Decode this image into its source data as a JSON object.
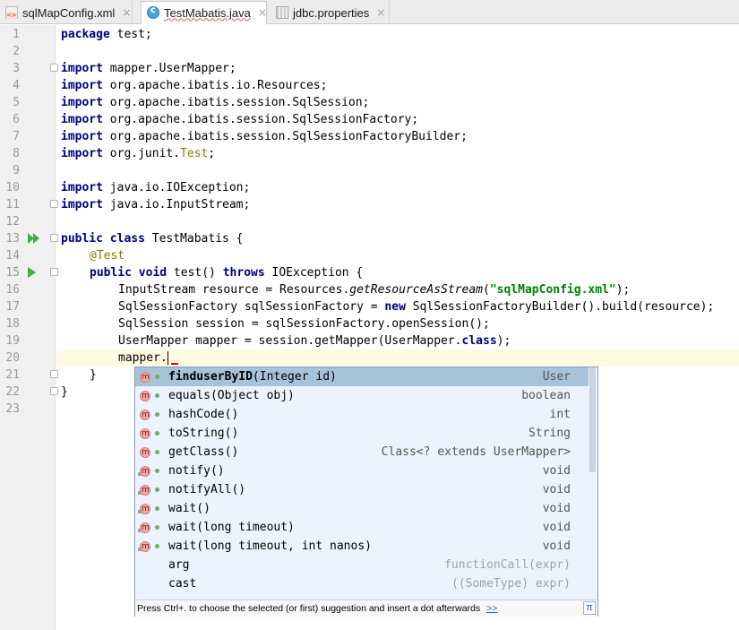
{
  "tabs": [
    {
      "label": "sqlMapConfig.xml",
      "icon": "xml-file-icon",
      "active": false
    },
    {
      "label": "TestMabatis.java",
      "icon": "java-class-icon",
      "active": true
    },
    {
      "label": "jdbc.properties",
      "icon": "properties-file-icon",
      "active": false
    }
  ],
  "close_glyph": "×",
  "line_numbers": [
    "1",
    "2",
    "3",
    "4",
    "5",
    "6",
    "7",
    "8",
    "9",
    "10",
    "11",
    "12",
    "13",
    "14",
    "15",
    "16",
    "17",
    "18",
    "19",
    "20",
    "21",
    "22",
    "23"
  ],
  "code": {
    "l1_kw": "package",
    "l1_rest": " test;",
    "import_kw": "import",
    "l3": " mapper.UserMapper;",
    "l4": " org.apache.ibatis.io.Resources;",
    "l5": " org.apache.ibatis.session.SqlSession;",
    "l6": " org.apache.ibatis.session.SqlSessionFactory;",
    "l7": " org.apache.ibatis.session.SqlSessionFactoryBuilder;",
    "l8_a": " org.junit.",
    "l8_cls": "Test",
    "l8_b": ";",
    "l10": " java.io.IOException;",
    "l11": " java.io.InputStream;",
    "l13_kw": "public class",
    "l13_rest": " TestMabatis {",
    "l14_ann": "@Test",
    "l15_kw1": "public void",
    "l15_mid": " test() ",
    "l15_kw2": "throws",
    "l15_rest": " IOException {",
    "l16_a": "InputStream resource = Resources.",
    "l16_method": "getResourceAsStream",
    "l16_b": "(",
    "l16_str": "\"sqlMapConfig.xml\"",
    "l16_c": ");",
    "l17_a": "SqlSessionFactory sqlSessionFactory = ",
    "l17_kw": "new",
    "l17_b": " SqlSessionFactoryBuilder().build(resource);",
    "l18": "SqlSession session = sqlSessionFactory.openSession();",
    "l19_a": "UserMapper mapper = session.getMapper(UserMapper.",
    "l19_kw": "class",
    "l19_b": ");",
    "l20": "mapper.",
    "l21": "}",
    "l22": "}"
  },
  "completion": {
    "items": [
      {
        "bold": "finduserByID",
        "rest": "(Integer id)",
        "type": "User",
        "selected": true,
        "lock": false
      },
      {
        "bold": "",
        "rest": "equals(Object obj)",
        "type": "boolean",
        "selected": false,
        "lock": false
      },
      {
        "bold": "",
        "rest": "hashCode()",
        "type": "int",
        "selected": false,
        "lock": false
      },
      {
        "bold": "",
        "rest": "toString()",
        "type": "String",
        "selected": false,
        "lock": false
      },
      {
        "bold": "",
        "rest": "getClass()",
        "type": "Class<? extends UserMapper>",
        "selected": false,
        "lock": false
      },
      {
        "bold": "",
        "rest": "notify()",
        "type": "void",
        "selected": false,
        "lock": true
      },
      {
        "bold": "",
        "rest": "notifyAll()",
        "type": "void",
        "selected": false,
        "lock": true
      },
      {
        "bold": "",
        "rest": "wait()",
        "type": "void",
        "selected": false,
        "lock": true
      },
      {
        "bold": "",
        "rest": "wait(long timeout)",
        "type": "void",
        "selected": false,
        "lock": true
      },
      {
        "bold": "",
        "rest": "wait(long timeout, int nanos)",
        "type": "void",
        "selected": false,
        "lock": true
      }
    ],
    "templates": [
      {
        "name": "arg",
        "type": "functionCall(expr)"
      },
      {
        "name": "cast",
        "type": "((SomeType) expr)"
      }
    ],
    "footer_text": "Press Ctrl+. to choose the selected (or first) suggestion and insert a dot afterwards",
    "footer_link": ">>",
    "pi_glyph": "π"
  }
}
